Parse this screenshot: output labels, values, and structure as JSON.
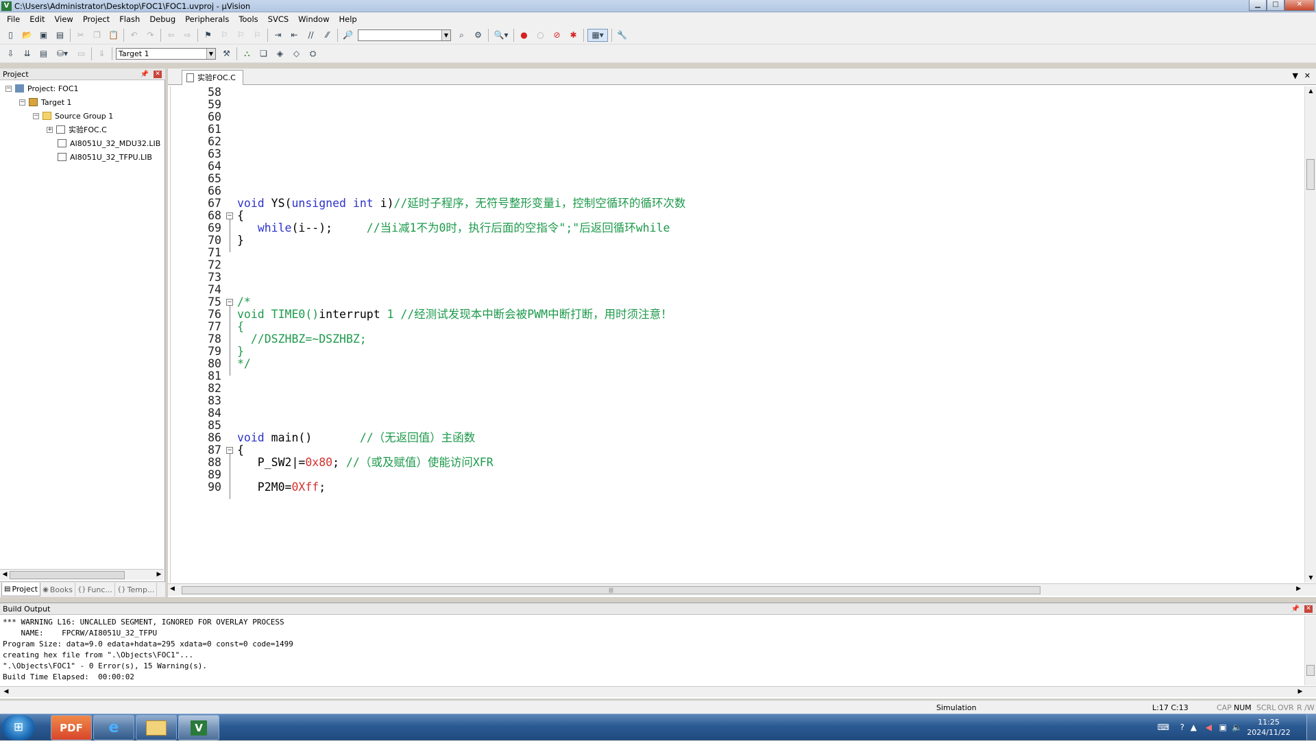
{
  "window": {
    "title": "C:\\Users\\Administrator\\Desktop\\FOC1\\FOC1.uvproj - µVision"
  },
  "menu": [
    "File",
    "Edit",
    "View",
    "Project",
    "Flash",
    "Debug",
    "Peripherals",
    "Tools",
    "SVCS",
    "Window",
    "Help"
  ],
  "toolbar2": {
    "target": "Target 1"
  },
  "project_panel": {
    "title": "Project",
    "tree": {
      "project": "Project: FOC1",
      "target": "Target 1",
      "group": "Source Group 1",
      "files": [
        "实验FOC.C",
        "AI8051U_32_MDU32.LIB",
        "AI8051U_32_TFPU.LIB"
      ]
    },
    "tabs": [
      "Project",
      "Books",
      "Func...",
      "Temp..."
    ]
  },
  "editor": {
    "tab": "实验FOC.C",
    "lines": [
      {
        "n": "58",
        "parts": []
      },
      {
        "n": "59",
        "parts": []
      },
      {
        "n": "60",
        "parts": []
      },
      {
        "n": "61",
        "parts": []
      },
      {
        "n": "62",
        "parts": []
      },
      {
        "n": "63",
        "parts": []
      },
      {
        "n": "64",
        "parts": []
      },
      {
        "n": "65",
        "parts": []
      },
      {
        "n": "66",
        "parts": []
      },
      {
        "n": "67",
        "parts": [
          {
            "t": "void",
            "c": "kw"
          },
          {
            "t": " YS(",
            "c": "pl"
          },
          {
            "t": "unsigned int",
            "c": "kw"
          },
          {
            "t": " i)",
            "c": "pl"
          },
          {
            "t": "//延时子程序，无符号整形变量i，控制空循环的循环次数",
            "c": "cm"
          }
        ]
      },
      {
        "n": "68",
        "fold": "open",
        "parts": [
          {
            "t": "{",
            "c": "pl"
          }
        ]
      },
      {
        "n": "69",
        "parts": [
          {
            "t": "   ",
            "c": "pl"
          },
          {
            "t": "while",
            "c": "kw"
          },
          {
            "t": "(i--);     ",
            "c": "pl"
          },
          {
            "t": "//当i减1不为0时，执行后面的空指令\";\"后返回循环while",
            "c": "cm"
          }
        ]
      },
      {
        "n": "70",
        "parts": [
          {
            "t": "}",
            "c": "pl"
          }
        ]
      },
      {
        "n": "71",
        "parts": []
      },
      {
        "n": "72",
        "parts": []
      },
      {
        "n": "73",
        "parts": []
      },
      {
        "n": "74",
        "parts": []
      },
      {
        "n": "75",
        "fold": "open",
        "parts": [
          {
            "t": "/*",
            "c": "cm"
          }
        ]
      },
      {
        "n": "76",
        "parts": [
          {
            "t": "void TIME0()",
            "c": "cm"
          },
          {
            "t": "interrupt",
            "c": "pl"
          },
          {
            "t": " 1 //经测试发现本中断会被PWM中断打断，用时须注意！",
            "c": "cm"
          }
        ]
      },
      {
        "n": "77",
        "parts": [
          {
            "t": "{",
            "c": "cm"
          }
        ]
      },
      {
        "n": "78",
        "parts": [
          {
            "t": "  //DSZHBZ=~DSZHBZ;",
            "c": "cm"
          }
        ]
      },
      {
        "n": "79",
        "parts": [
          {
            "t": "}",
            "c": "cm"
          }
        ]
      },
      {
        "n": "80",
        "parts": [
          {
            "t": "*/",
            "c": "cm"
          }
        ]
      },
      {
        "n": "81",
        "parts": []
      },
      {
        "n": "82",
        "parts": []
      },
      {
        "n": "83",
        "parts": []
      },
      {
        "n": "84",
        "parts": []
      },
      {
        "n": "85",
        "parts": []
      },
      {
        "n": "86",
        "parts": [
          {
            "t": "void",
            "c": "kw"
          },
          {
            "t": " main()       ",
            "c": "pl"
          },
          {
            "t": "//（无返回值）主函数",
            "c": "cm"
          }
        ]
      },
      {
        "n": "87",
        "fold": "open",
        "parts": [
          {
            "t": "{",
            "c": "pl"
          }
        ]
      },
      {
        "n": "88",
        "parts": [
          {
            "t": "   P_SW2|=",
            "c": "pl"
          },
          {
            "t": "0x80",
            "c": "nm"
          },
          {
            "t": "; ",
            "c": "pl"
          },
          {
            "t": "//（或及赋值）使能访问XFR",
            "c": "cm"
          }
        ]
      },
      {
        "n": "89",
        "parts": []
      },
      {
        "n": "90",
        "parts": [
          {
            "t": "   P2M0=",
            "c": "pl"
          },
          {
            "t": "0Xff",
            "c": "nm"
          },
          {
            "t": ";",
            "c": "pl"
          }
        ]
      }
    ]
  },
  "build_output": {
    "title": "Build Output",
    "lines": [
      "*** WARNING L16: UNCALLED SEGMENT, IGNORED FOR OVERLAY PROCESS",
      "    NAME:    FPCRW/AI8051U_32_TFPU",
      "Program Size: data=9.0 edata+hdata=295 xdata=0 const=0 code=1499",
      "creating hex file from \".\\Objects\\FOC1\"...",
      "\".\\Objects\\FOC1\" - 0 Error(s), 15 Warning(s).",
      "Build Time Elapsed:  00:00:02"
    ]
  },
  "status": {
    "mode": "Simulation",
    "position": "L:17 C:13",
    "cap": "CAP",
    "num": "NUM",
    "scrl": "SCRL",
    "ovr": "OVR",
    "rw": "R /W"
  },
  "taskbar": {
    "apps": [
      "PDF",
      "e",
      "folder",
      "V"
    ],
    "time": "11:25",
    "date": "2024/11/22"
  }
}
